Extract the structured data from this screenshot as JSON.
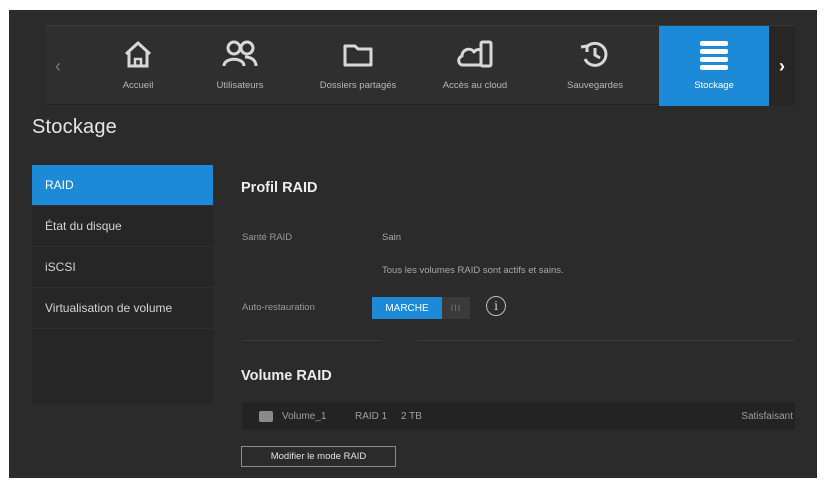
{
  "nav": {
    "prev_glyph": "‹",
    "next_glyph": "›",
    "items": [
      {
        "label": "Accueil",
        "icon": "home-icon"
      },
      {
        "label": "Utilisateurs",
        "icon": "users-icon"
      },
      {
        "label": "Dossiers partagés",
        "icon": "folder-icon"
      },
      {
        "label": "Accès au cloud",
        "icon": "cloud-device-icon"
      },
      {
        "label": "Sauvegardes",
        "icon": "backup-history-icon"
      },
      {
        "label": "Stockage",
        "icon": "storage-icon",
        "active": true
      }
    ]
  },
  "page": {
    "title": "Stockage"
  },
  "sidebar": {
    "items": [
      {
        "label": "RAID",
        "active": true
      },
      {
        "label": "État du disque"
      },
      {
        "label": "iSCSI"
      },
      {
        "label": "Virtualisation de volume"
      }
    ]
  },
  "raid_profile": {
    "title": "Profil RAID",
    "health_label": "Santé RAID",
    "health_value": "Sain",
    "health_detail": "Tous les volumes RAID sont actifs et sains.",
    "auto_restore_label": "Auto-restauration",
    "toggle_on_label": "MARCHE",
    "toggle_grip": "III"
  },
  "raid_volume": {
    "title": "Volume RAID",
    "rows": [
      {
        "name": "Volume_1",
        "level": "RAID 1",
        "size": "2 TB",
        "status": "Satisfaisant"
      }
    ],
    "modify_button": "Modifier le mode RAID"
  },
  "colors": {
    "accent": "#1c8ad6",
    "background": "#2b2b2c",
    "panel": "#262627"
  }
}
